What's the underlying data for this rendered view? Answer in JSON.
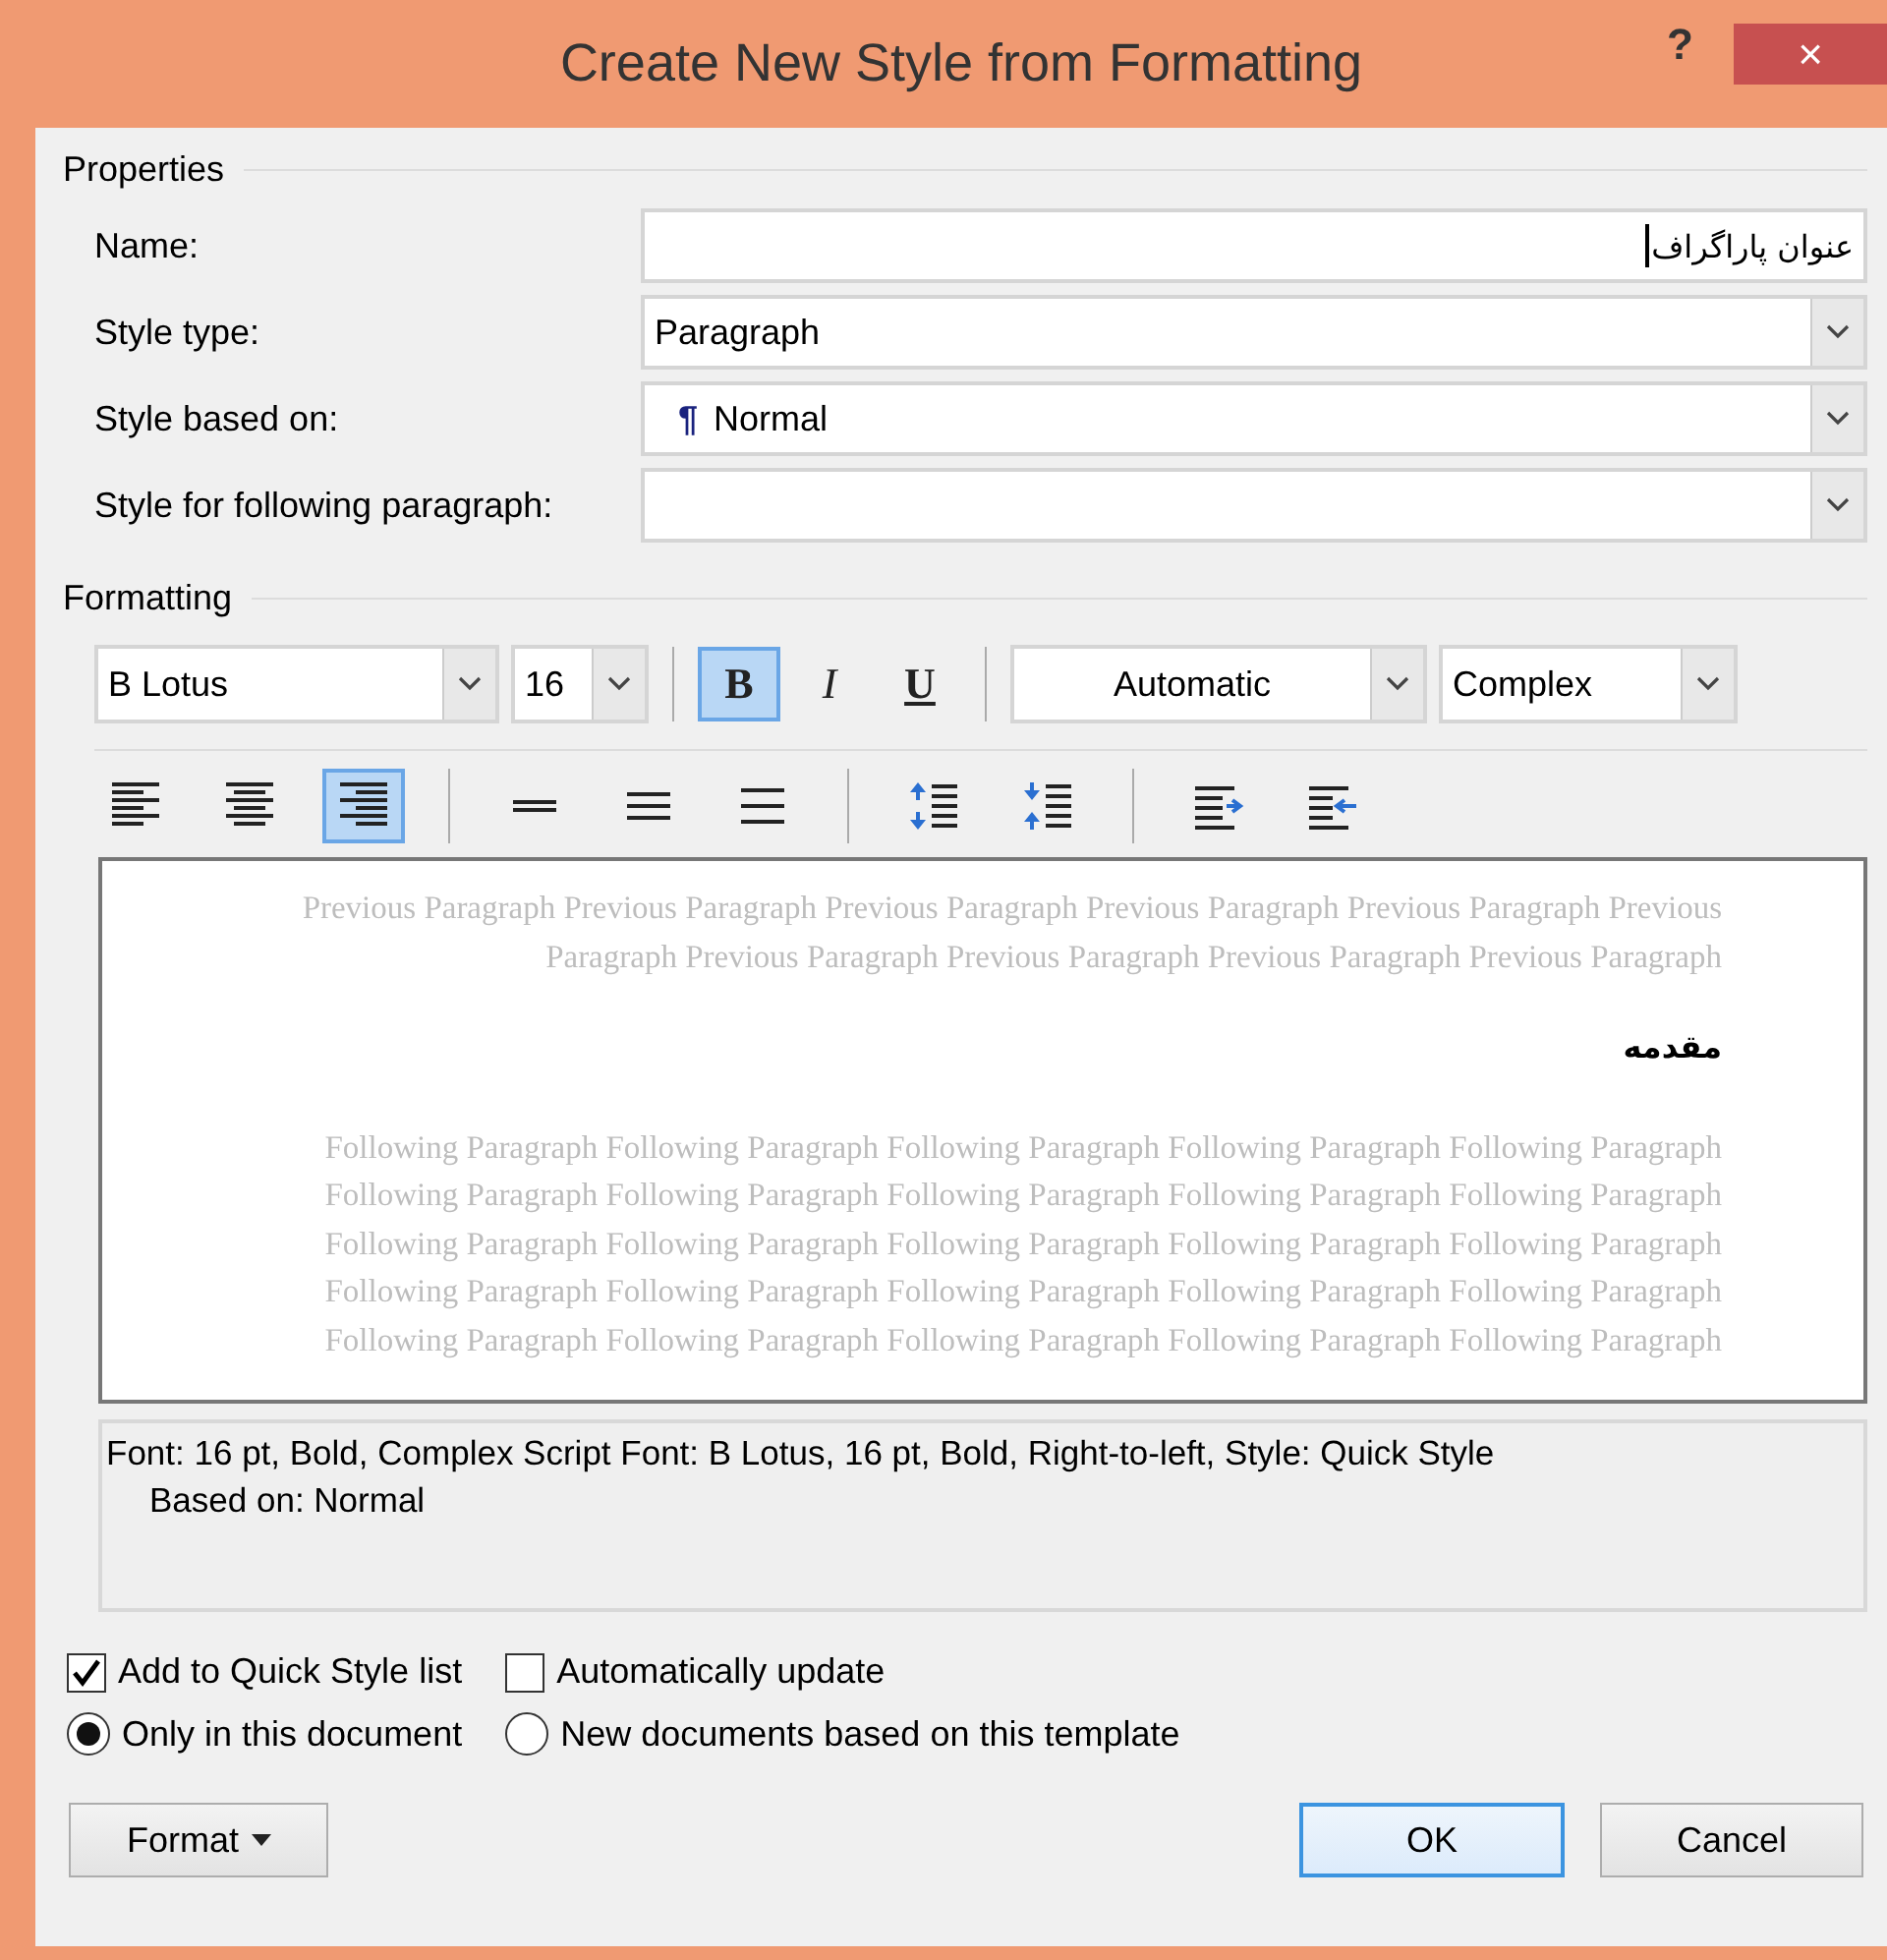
{
  "window": {
    "title": "Create New Style from Formatting",
    "help_button": "?",
    "close_button": "×"
  },
  "properties": {
    "heading": "Properties",
    "fields": [
      {
        "label": "Name:",
        "kind": "text",
        "value": "عنوان پاراگراف",
        "focused": true
      },
      {
        "label": "Style type:",
        "kind": "dropdown",
        "value": "Paragraph"
      },
      {
        "label": "Style based on:",
        "kind": "dropdown",
        "value": "Normal",
        "mark": "¶"
      },
      {
        "label": "Style for following paragraph:",
        "kind": "dropdown"
      }
    ]
  },
  "formatting": {
    "heading": "Formatting",
    "font": "B Lotus",
    "size": "16",
    "styles": [
      {
        "kind": "bold",
        "label": "B",
        "selected": true
      },
      {
        "kind": "italic",
        "label": "I",
        "selected": false
      },
      {
        "kind": "underline",
        "label": "U",
        "selected": false
      }
    ],
    "color_choice": "Automatic",
    "script": "Complex",
    "tool_groups": [
      {
        "tools": [
          {
            "kind": "align-left",
            "selected": false
          },
          {
            "kind": "align-center",
            "selected": false
          },
          {
            "kind": "align-right",
            "selected": true
          }
        ]
      },
      {
        "tools": [
          {
            "kind": "line-single",
            "selected": false
          },
          {
            "kind": "line-one-half",
            "selected": false
          },
          {
            "kind": "line-double",
            "selected": false
          }
        ]
      },
      {
        "tools": [
          {
            "kind": "space-increase",
            "selected": false
          },
          {
            "kind": "space-decrease",
            "selected": false
          }
        ]
      },
      {
        "tools": [
          {
            "kind": "indent-increase",
            "selected": false
          },
          {
            "kind": "indent-decrease",
            "selected": false
          }
        ]
      }
    ]
  },
  "preview": {
    "previous_lines": [
      "Previous Paragraph Previous Paragraph Previous Paragraph Previous Paragraph Previous Paragraph Previous",
      "Paragraph Previous Paragraph Previous Paragraph Previous Paragraph Previous Paragraph"
    ],
    "sample": "مقدمه",
    "following_lines": [
      "Following Paragraph Following Paragraph Following Paragraph Following Paragraph Following Paragraph",
      "Following Paragraph Following Paragraph Following Paragraph Following Paragraph Following Paragraph",
      "Following Paragraph Following Paragraph Following Paragraph Following Paragraph Following Paragraph",
      "Following Paragraph Following Paragraph Following Paragraph Following Paragraph Following Paragraph",
      "Following Paragraph Following Paragraph Following Paragraph Following Paragraph Following Paragraph"
    ]
  },
  "description": [
    "Font: 16 pt, Bold, Complex Script Font: B Lotus, 16 pt, Bold, Right-to-left, Style: Quick Style",
    "Based on: Normal"
  ],
  "checkboxes": [
    {
      "label": "Add to Quick Style list",
      "checked": true
    },
    {
      "label": "Automatically update",
      "checked": false
    }
  ],
  "radios": [
    {
      "label": "Only in this document",
      "selected": true
    },
    {
      "label": "New documents based on this template",
      "selected": false
    }
  ],
  "buttons": [
    {
      "kind": "menu",
      "label": "Format"
    },
    {
      "kind": "default",
      "label": "OK"
    },
    {
      "kind": "plain",
      "label": "Cancel"
    }
  ]
}
